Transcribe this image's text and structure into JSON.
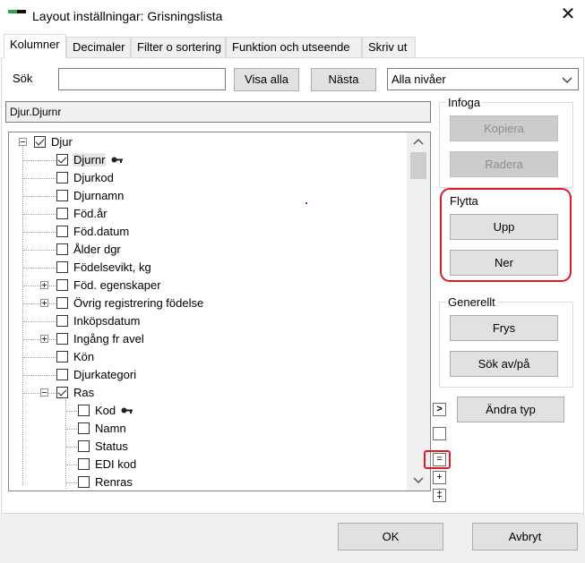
{
  "window": {
    "title": "Layout inställningar: Grisningslista"
  },
  "tabs": [
    {
      "label": "Kolumner",
      "active": true
    },
    {
      "label": "Decimaler"
    },
    {
      "label": "Filter o sortering"
    },
    {
      "label": "Funktion och utseende"
    },
    {
      "label": "Skriv ut"
    }
  ],
  "search": {
    "label": "Sök",
    "value": "",
    "placeholder": "",
    "show_all_label": "Visa alla",
    "next_label": "Nästa",
    "level_select_value": "Alla nivåer"
  },
  "selected_path": "Djur.Djurnr",
  "tree": {
    "root": {
      "label": "Djur",
      "checked": true
    },
    "items": [
      {
        "label": "Djurnr",
        "checked": true,
        "selected": true,
        "key_icon": true
      },
      {
        "label": "Djurkod",
        "checked": false
      },
      {
        "label": "Djurnamn",
        "checked": false
      },
      {
        "label": "Föd.år",
        "checked": false
      },
      {
        "label": "Föd.datum",
        "checked": false
      },
      {
        "label": "Ålder dgr",
        "checked": false
      },
      {
        "label": "Födelsevikt, kg",
        "checked": false
      },
      {
        "label": "Föd. egenskaper",
        "checked": false,
        "expandable": true
      },
      {
        "label": "Övrig registrering födelse",
        "checked": false,
        "expandable": true
      },
      {
        "label": "Inköpsdatum",
        "checked": false
      },
      {
        "label": "Ingång fr avel",
        "checked": false,
        "expandable": true
      },
      {
        "label": "Kön",
        "checked": false
      },
      {
        "label": "Djurkategori",
        "checked": false
      },
      {
        "label": "Ras",
        "checked": true,
        "expanded": true
      }
    ],
    "ras_children": [
      {
        "label": "Kod",
        "checked": false,
        "key_icon": true
      },
      {
        "label": "Namn",
        "checked": false
      },
      {
        "label": "Status",
        "checked": false
      },
      {
        "label": "EDI kod",
        "checked": false
      },
      {
        "label": "Renras",
        "checked": false
      }
    ]
  },
  "groups": {
    "infoga": {
      "title": "Infoga",
      "copy_label": "Kopiera",
      "delete_label": "Radera"
    },
    "flytta": {
      "title": "Flytta",
      "up_label": "Upp",
      "down_label": "Ner"
    },
    "generellt": {
      "title": "Generellt",
      "freeze_label": "Frys",
      "search_toggle_label": "Sök av/på"
    }
  },
  "side_buttons": {
    "change_type_label": "Ändra typ",
    "arrow_glyph": ">",
    "equals_glyph": "=",
    "plus_glyph": "+",
    "double_dagger_glyph": "‡"
  },
  "footer": {
    "ok_label": "OK",
    "cancel_label": "Avbryt"
  },
  "colors": {
    "highlight": "#e01b24",
    "app_icon_green": "#27a844"
  },
  "icons": [
    "close-icon",
    "chevron-down-icon",
    "key-icon",
    "chevron-up-icon",
    "chevron-right-icon"
  ]
}
